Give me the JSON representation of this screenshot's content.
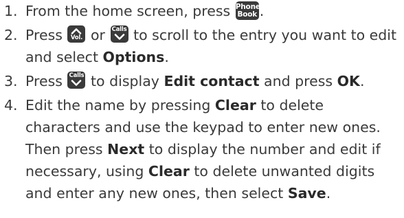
{
  "steps": [
    {
      "num": "1.",
      "t1": "From the home screen, press",
      "key": {
        "icon": "phone-book-key-icon",
        "line1": "Phone",
        "line2": "Book"
      },
      "t2": "."
    },
    {
      "num": "2.",
      "t1": "Press",
      "key_up": {
        "icon": "vol-up-key-icon",
        "label": "Vol."
      },
      "t2": "or",
      "key_down": {
        "icon": "calls-down-key-icon",
        "label": "Calls"
      },
      "t3": "to scroll to the entry you want to edit and select",
      "b1": "Options",
      "t4": "."
    },
    {
      "num": "3.",
      "t1": "Press",
      "key_down": {
        "icon": "calls-down-key-icon",
        "label": "Calls"
      },
      "t2": "to display",
      "b1": "Edit contact",
      "t3": "and press",
      "b2": "OK",
      "t4": "."
    },
    {
      "num": "4.",
      "t1": "Edit the name by pressing",
      "b1": "Clear",
      "t2": "to delete characters and use the keypad to enter new ones. Then press",
      "b2": "Next",
      "t3": "to display the number and edit if necessary, using",
      "b3": "Clear",
      "t4": "to delete unwanted digits and enter any new ones, then select",
      "b4": "Save",
      "t5": "."
    }
  ],
  "colors": {
    "text": "#3a3a3a",
    "key_background": "#3a3a3a",
    "key_text": "#ffffff"
  }
}
